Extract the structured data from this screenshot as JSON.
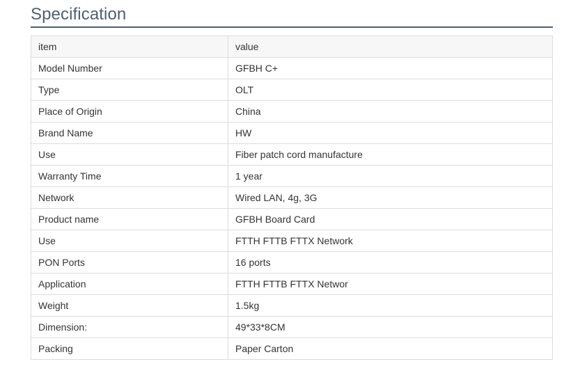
{
  "section": {
    "title": "Specification"
  },
  "table": {
    "columns": [
      "item",
      "value"
    ],
    "rows": [
      [
        "Model Number",
        "GFBH C+"
      ],
      [
        "Type",
        "OLT"
      ],
      [
        "Place of Origin",
        "China"
      ],
      [
        "Brand Name",
        "HW"
      ],
      [
        "Use",
        "Fiber patch cord manufacture"
      ],
      [
        "Warranty Time",
        "1 year"
      ],
      [
        "Network",
        "Wired LAN, 4g, 3G"
      ],
      [
        "Product name",
        "GFBH Board Card"
      ],
      [
        "Use",
        "FTTH FTTB FTTX Network"
      ],
      [
        "PON Ports",
        "16 ports"
      ],
      [
        "Application",
        "FTTH FTTB FTTX Networ"
      ],
      [
        "Weight",
        "1.5kg"
      ],
      [
        "Dimension:",
        "49*33*8CM"
      ],
      [
        "Packing",
        "Paper Carton"
      ]
    ]
  }
}
